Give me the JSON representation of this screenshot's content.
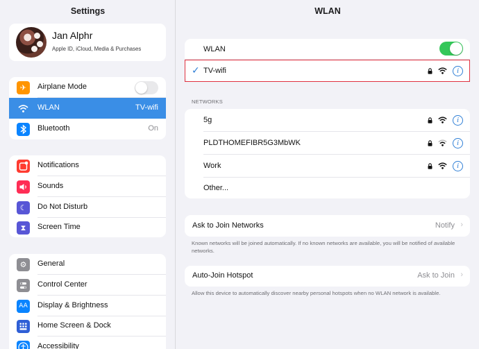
{
  "sidebar": {
    "title": "Settings",
    "profile": {
      "name": "Jan Alphr",
      "subtitle": "Apple ID, iCloud, Media & Purchases"
    },
    "group1": [
      {
        "label": "Airplane Mode",
        "icon": "airplane-icon",
        "color": "#ff9500",
        "value": ""
      },
      {
        "label": "WLAN",
        "icon": "wifi-icon",
        "color": "#3a8ee6",
        "value": "TV-wifi"
      },
      {
        "label": "Bluetooth",
        "icon": "bluetooth-icon",
        "color": "#0a84ff",
        "value": "On"
      }
    ],
    "group2": [
      {
        "label": "Notifications",
        "icon": "notifications-icon",
        "color": "#ff3b30"
      },
      {
        "label": "Sounds",
        "icon": "sounds-icon",
        "color": "#ff2d55"
      },
      {
        "label": "Do Not Disturb",
        "icon": "moon-icon",
        "color": "#5856d6"
      },
      {
        "label": "Screen Time",
        "icon": "hourglass-icon",
        "color": "#5856d6"
      }
    ],
    "group3": [
      {
        "label": "General",
        "icon": "gear-icon",
        "color": "#8e8e93"
      },
      {
        "label": "Control Center",
        "icon": "control-center-icon",
        "color": "#8e8e93"
      },
      {
        "label": "Display & Brightness",
        "icon": "display-icon",
        "color": "#0a84ff",
        "glyph": "AA"
      },
      {
        "label": "Home Screen & Dock",
        "icon": "home-screen-icon",
        "color": "#0a84ff"
      },
      {
        "label": "Accessibility",
        "icon": "accessibility-icon",
        "color": "#0a84ff"
      }
    ]
  },
  "pane": {
    "title": "WLAN",
    "wlan_label": "WLAN",
    "current_network": "TV-wifi",
    "networks_header": "NETWORKS",
    "networks": [
      {
        "name": "5g"
      },
      {
        "name": "PLDTHOMEFIBR5G3MbWK"
      },
      {
        "name": "Work"
      }
    ],
    "other_label": "Other...",
    "ask_join": {
      "label": "Ask to Join Networks",
      "value": "Notify",
      "note": "Known networks will be joined automatically. If no known networks are available, you will be notified of available networks."
    },
    "auto_join": {
      "label": "Auto-Join Hotspot",
      "value": "Ask to Join",
      "note": "Allow this device to automatically discover nearby personal hotspots when no WLAN network is available."
    }
  },
  "colors": {
    "accent": "#2f7fd6",
    "selection": "#3a8ee6",
    "toggle_on": "#34c759",
    "highlight": "#e0313f"
  }
}
